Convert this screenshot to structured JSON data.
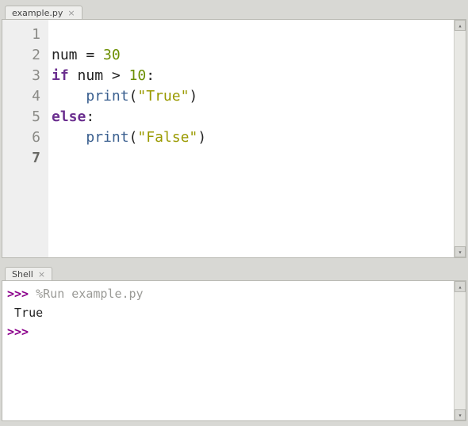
{
  "editor": {
    "tab_label": "example.py",
    "line_numbers": [
      "1",
      "2",
      "3",
      "4",
      "5",
      "6",
      "7"
    ],
    "current_line_index": 6,
    "code_lines": [
      {
        "tokens": []
      },
      {
        "tokens": [
          {
            "t": "num",
            "v": ""
          },
          {
            "t": "plain",
            "v": "num = "
          },
          {
            "t": "num",
            "v": "30"
          }
        ]
      },
      {
        "tokens": [
          {
            "t": "kw",
            "v": "if"
          },
          {
            "t": "plain",
            "v": " num > "
          },
          {
            "t": "num",
            "v": "10"
          },
          {
            "t": "plain",
            "v": ":"
          }
        ]
      },
      {
        "tokens": [
          {
            "t": "plain",
            "v": "    "
          },
          {
            "t": "fn",
            "v": "print"
          },
          {
            "t": "plain",
            "v": "("
          },
          {
            "t": "str",
            "v": "\"True\""
          },
          {
            "t": "plain",
            "v": ")"
          }
        ]
      },
      {
        "tokens": [
          {
            "t": "kw",
            "v": "else"
          },
          {
            "t": "plain",
            "v": ":"
          }
        ]
      },
      {
        "tokens": [
          {
            "t": "plain",
            "v": "    "
          },
          {
            "t": "fn",
            "v": "print"
          },
          {
            "t": "plain",
            "v": "("
          },
          {
            "t": "str",
            "v": "\"False\""
          },
          {
            "t": "plain",
            "v": ")"
          }
        ]
      },
      {
        "tokens": []
      }
    ]
  },
  "shell": {
    "tab_label": "Shell",
    "prompt": ">>>",
    "run_cmd": "%Run example.py",
    "output": " True"
  }
}
